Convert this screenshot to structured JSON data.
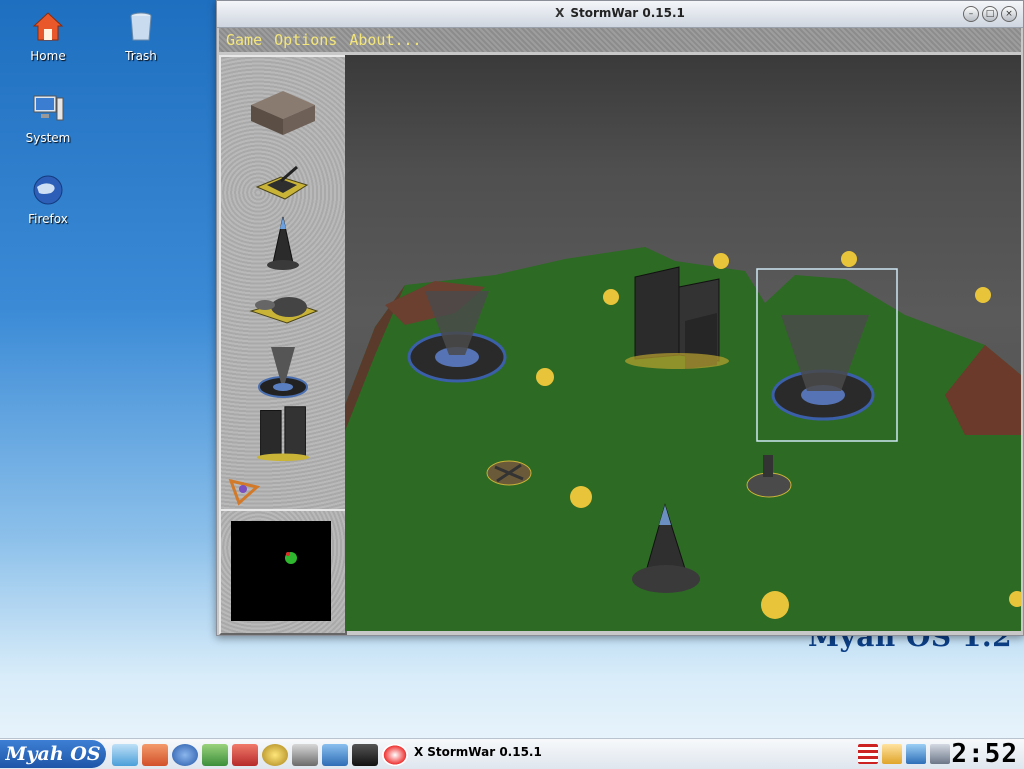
{
  "desktop": {
    "icons": [
      {
        "label": "Home"
      },
      {
        "label": "Trash"
      },
      {
        "label": "System"
      },
      {
        "label": "Firefox"
      }
    ],
    "brand_text": "Myah OS 1.2"
  },
  "window": {
    "title": "StormWar 0.15.1",
    "controls": [
      "minimize-icon",
      "maximize-icon",
      "close-icon"
    ]
  },
  "menubar": {
    "items": [
      "Game",
      "Options",
      "About..."
    ]
  },
  "sidebar": {
    "units": [
      "ground-block",
      "tank-unit",
      "tower-unit",
      "hovercraft-unit",
      "storm-generator",
      "tower-buildings",
      "cursor-marker"
    ]
  },
  "taskbar": {
    "start_label": "Myah OS",
    "task_title": "StormWar 0.15.1",
    "clock": "2:52",
    "colors": {
      "start": "#1e56a8",
      "menu_text": "#f4e67a"
    }
  }
}
